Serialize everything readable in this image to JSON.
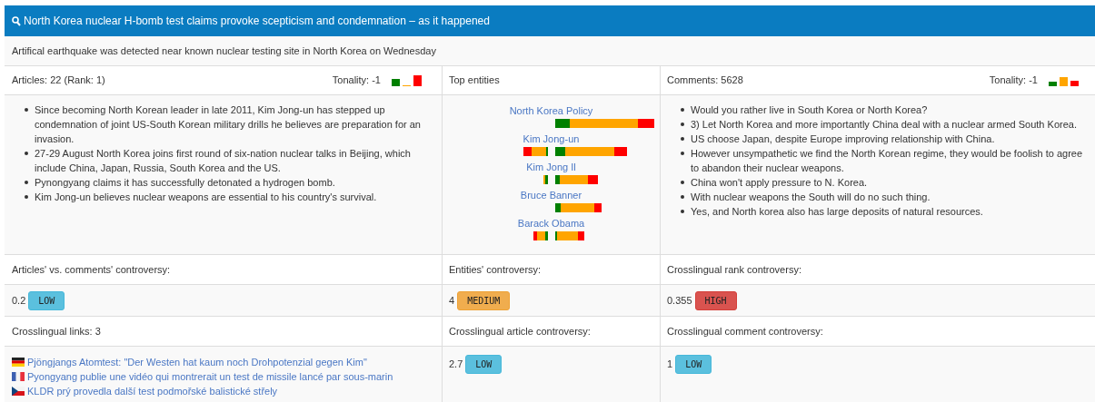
{
  "header": {
    "title": "North Korea nuclear H-bomb test claims provoke scepticism and condemnation – as it happened"
  },
  "subtitle": "Artifical earthquake was detected near known nuclear testing site in North Korea on Wednesday",
  "articles": {
    "label": "Articles: 22 (Rank: 1)",
    "tonality_label": "Tonality: -1",
    "tonality_bars": [
      {
        "color": "#008000"
      },
      {
        "color": "#ffa500"
      },
      {
        "color": "#ff0000"
      }
    ],
    "bullets": [
      "Since becoming North Korean leader in late 2011, Kim Jong-un has stepped up condemnation of joint US-South Korean military drills he believes are preparation for an invasion.",
      "27-29 August North Korea joins first round of six-nation nuclear talks in Beijing, which include China, Japan, Russia, South Korea and the US.",
      "Pynongyang claims it has successfully detonated a hydrogen bomb.",
      "Kim Jong-un believes nuclear weapons are essential to his country's survival."
    ]
  },
  "top_entities": {
    "label": "Top entities",
    "entities": [
      {
        "name": "North Korea Policy"
      },
      {
        "name": "Kim Jong-un"
      },
      {
        "name": "Kim Jong Il"
      },
      {
        "name": "Bruce Banner"
      },
      {
        "name": "Barack Obama"
      }
    ]
  },
  "comments": {
    "label": "Comments: 5628",
    "tonality_label": "Tonality: -1",
    "tonality_bars": [
      {
        "color": "#008000"
      },
      {
        "color": "#ffa500"
      },
      {
        "color": "#ff0000"
      }
    ],
    "bullets": [
      "Would you rather live in South Korea or North Korea?",
      "3) Let North Korea and more importantly China deal with a nuclear armed South Korea.",
      "US choose Japan, despite Europe improving relationship with China.",
      "However unsympathetic we find the North Korean regime, they would be foolish to agree to abandon their nuclear weapons.",
      "China won't apply pressure to N. Korea.",
      "With nuclear weapons the South will do no such thing.",
      "Yes, and North korea also has large deposits of natural resources."
    ]
  },
  "metric_rows": [
    [
      {
        "label": "Articles' vs. comments' controversy:",
        "value": "0.2",
        "badge": {
          "text": "LOW",
          "kind": "low"
        }
      },
      {
        "label": "Entities' controversy:",
        "value": "4",
        "badge": {
          "text": "MEDIUM",
          "kind": "medium"
        }
      },
      {
        "label": "Crosslingual rank controversy:",
        "value": "0.355",
        "badge": {
          "text": "HIGH",
          "kind": "high"
        }
      }
    ],
    [
      {
        "label": "Crosslingual links: 3",
        "links": [
          {
            "kind": "de",
            "text": "Pjöngjangs Atomtest: \"Der Westen hat kaum noch Drohpotenzial gegen Kim\""
          },
          {
            "kind": "fr",
            "text": "Pyongyang publie une vidéo qui montrerait un test de missile lancé par sous-marin"
          },
          {
            "kind": "cz",
            "text": "KLDR prý provedla další test podmořské balistické střely"
          }
        ]
      },
      {
        "label": "Crosslingual article controversy:",
        "value": "2.7",
        "badge": {
          "text": "LOW",
          "kind": "low"
        }
      },
      {
        "label": "Crosslingual comment controversy:",
        "value": "1",
        "badge": {
          "text": "LOW",
          "kind": "low"
        }
      }
    ]
  ]
}
